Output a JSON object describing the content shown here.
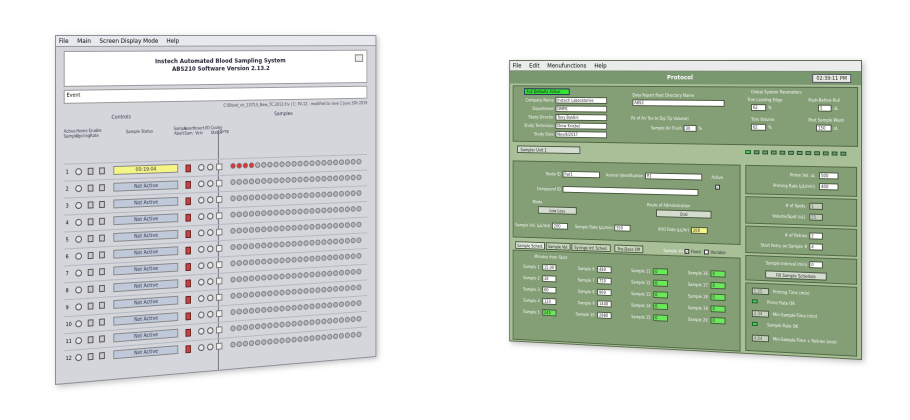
{
  "left": {
    "menu": [
      "File",
      "Main",
      "Screen Display Mode",
      "Help"
    ],
    "title1": "Instech Automated Blood Sampling System",
    "title2": "ABS210 Software Version 2.13.2",
    "event_label": "Event",
    "path_text": "C:\\Blood_vh_13\\TLS_New_TC.2013.f.lv  |  C: PV-12 - modified to view 1 June 30h 2019",
    "controls_label": "Controls",
    "samples_label": "Samples",
    "col_headers": [
      "Active Sampler",
      "Home Cycling",
      "Enable Rate",
      "Sample Status",
      "Sample Abort",
      "Insert Sam.",
      "Insert Vein",
      "I/O",
      "Cooler Status",
      "Temp"
    ],
    "rows": [
      {
        "num": "1",
        "status": "00:19:04"
      },
      {
        "num": "2",
        "status": "Not Active"
      },
      {
        "num": "3",
        "status": "Not Active"
      },
      {
        "num": "4",
        "status": "Not Active"
      },
      {
        "num": "5",
        "status": "Not Active"
      },
      {
        "num": "6",
        "status": "Not Active"
      },
      {
        "num": "7",
        "status": "Not Active"
      },
      {
        "num": "8",
        "status": "Not Active"
      },
      {
        "num": "9",
        "status": "Not Active"
      },
      {
        "num": "10",
        "status": "Not Active"
      },
      {
        "num": "11",
        "status": "Not Active"
      },
      {
        "num": "12",
        "status": "Not Active"
      }
    ],
    "red_dot_count": 4
  },
  "right": {
    "menu": [
      "File",
      "Edit",
      "Menufunctions",
      "Help"
    ],
    "title": "Protocol",
    "clock": "02:39:11 PM",
    "defaults_badge": "Full Defaults Active",
    "company_name_label": "Company Name",
    "company_name": "Instech Laboratories",
    "department_label": "Department",
    "department": "DMPK",
    "director_label": "Study Director",
    "director": "Tony Baldini",
    "technician_label": "Study Technician",
    "technician": "Drew Kriebel",
    "date_label": "Study Date",
    "date": "Nov/8/2017",
    "report_dir_label": "Data Report Root Directory Name",
    "report_dir": "ABS2",
    "air_tee_label": "(% of Air Tee to Dip Tip Volume)",
    "air_flush_label": "Sample Air Flush",
    "air_flush": "30",
    "pct": "%",
    "global_title": "Global System Parameters",
    "trim_lead_label": "Trim Leading Edge",
    "trim_lead": "62",
    "push_label": "Push-Before-Pull",
    "push": "5",
    "ul": "uL",
    "trim_vol_label": "Trim Volume",
    "trim_vol": "62",
    "post_wash_label": "Post Sample Wash",
    "post_wash": "150",
    "sampler_unit": "Sampler Unit 1",
    "study_id_label": "Study ID",
    "study_id": "Rat1",
    "animal_id_label": "Animal Identification",
    "animal_id": "R1",
    "active_label": "Active",
    "compound_label": "Compound ID",
    "mode_label": "Mode",
    "mode": "Low Loss",
    "route_label": "Route of Administration",
    "route": "Oral",
    "sample_vol_label": "Sample Vol. (µL/Vol)",
    "sample_vol": "200",
    "sample_rate_label": "Sample Rate (µL/min)",
    "sample_rate": "350",
    "kvo_label": "KVO Rate (µL/hr)",
    "kvo": "200",
    "tabs": [
      "Sample Sched.",
      "Sample Vol.",
      "Syringe Inf. Sched.",
      "Pre-Dose Off"
    ],
    "sv_label": "Sample Vol.",
    "fixed_label": "Fixed",
    "variable_label": "Variable",
    "minutes_label": "Minutes from Start",
    "samples": [
      {
        "l": "Sample 1",
        "v": "15.00"
      },
      {
        "l": "Sample 2",
        "v": "30"
      },
      {
        "l": "Sample 3",
        "v": "60"
      },
      {
        "l": "Sample 4",
        "v": "120"
      },
      {
        "l": "Sample 5",
        "v": "240"
      },
      {
        "l": "Sample 6",
        "v": "480"
      },
      {
        "l": "Sample 7",
        "v": "720"
      },
      {
        "l": "Sample 8",
        "v": "960"
      },
      {
        "l": "Sample 9",
        "v": "1440"
      },
      {
        "l": "Sample 10",
        "v": "2880"
      },
      {
        "l": "Sample 11",
        "v": "0"
      },
      {
        "l": "Sample 12",
        "v": "0"
      },
      {
        "l": "Sample 13",
        "v": "0"
      },
      {
        "l": "Sample 14",
        "v": "0"
      },
      {
        "l": "Sample 15",
        "v": "0"
      },
      {
        "l": "Sample 16",
        "v": "0"
      },
      {
        "l": "Sample 17",
        "v": "0"
      },
      {
        "l": "Sample 18",
        "v": "0"
      },
      {
        "l": "Sample 19",
        "v": "0"
      },
      {
        "l": "Sample 20",
        "v": "0"
      }
    ],
    "prime_vol_label": "Prime Vol. uL",
    "prime_vol": "500",
    "priming_rate_label": "Priming Rate (µL/min)",
    "priming_rate": "400",
    "num_spots_label": "# of Spots",
    "num_spots": "1",
    "vol_spot_label": "Volume/Spot (uL)",
    "vol_spot": "15",
    "retries_label": "# of Retries",
    "retries": "2",
    "start_retry_label": "Start Retry on Sample #",
    "start_retry": "4",
    "interval_label": "Sample Interval (min)",
    "interval": "0",
    "fill_btn": "Fill Sample Schedule",
    "priming_time_label": "Priming Time (min)",
    "priming_time": "1.25",
    "prime_ok": "Prime Rate OK",
    "min_sample_label": "Min-Sample-Time (min)",
    "min_sample": "2.34",
    "sample_ok": "Sample Rate OK",
    "min_retries_label": "Min-Sample-Time + Retries (min)",
    "min_retries": "4.64"
  }
}
